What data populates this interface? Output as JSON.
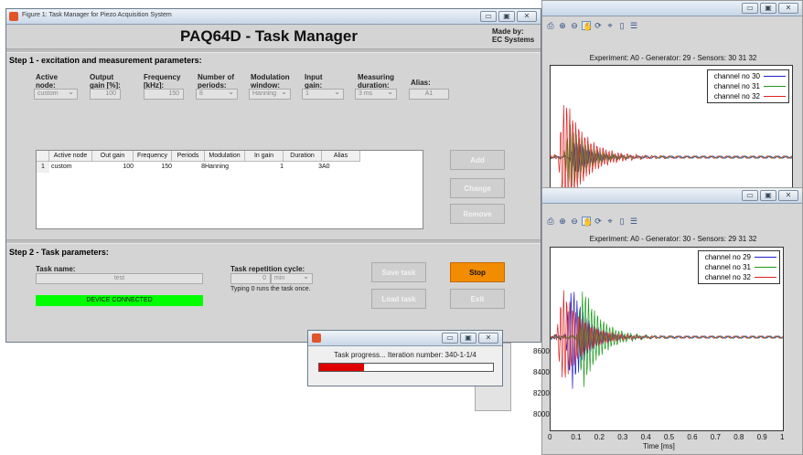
{
  "tm": {
    "window_title": "Figure 1: Task Manager for Piezo Acquisition System",
    "title": "PAQ64D - Task Manager",
    "made_by_1": "Made by:",
    "made_by_2": "EC Systems",
    "step1": "Step 1 - excitation and measurement parameters:",
    "labels": {
      "node": "Active\nnode:",
      "gain": "Output\ngain [%]:",
      "freq": "Frequency\n[kHz]:",
      "periods": "Number of\nperiods:",
      "window": "Modulation\nwindow:",
      "ingain": "Input\ngain:",
      "duration": "Measuring\nduration:",
      "alias": "Alias:"
    },
    "values": {
      "node": "custom",
      "gain": "100",
      "freq": "150",
      "periods": "8",
      "window": "Hanning",
      "ingain": "1",
      "duration": "3 ms",
      "alias": "A1"
    },
    "table": {
      "headers": [
        "",
        "Active node",
        "Out gain",
        "Frequency",
        "Periods",
        "Modulation",
        "In gain",
        "Duration",
        "Alias"
      ],
      "rows": [
        [
          "1",
          "custom",
          "100",
          "150",
          "8",
          "Hanning",
          "1",
          "3",
          "A0"
        ]
      ]
    },
    "buttons": {
      "add": "Add",
      "change": "Change",
      "remove": "Remove",
      "save": "Save task",
      "load": "Load task",
      "stop": "Stop",
      "exit": "Exit"
    },
    "step2": "Step 2 - Task parameters:",
    "task_name_label": "Task name:",
    "task_name": "test",
    "rep_label": "Task repetition cycle:",
    "rep_value": "0",
    "rep_unit": "min",
    "rep_note": "Typing 0 runs the task once.",
    "status": "DEVICE CONNECTED",
    "colors": {
      "stop": "#f28c00",
      "status": "#00ff00"
    }
  },
  "progress": {
    "text": "Task progress... Iteration number: 340-1-1/4",
    "fraction": 0.26,
    "color": "#e00000"
  },
  "plots": {
    "colors": [
      "#1f1fcf",
      "#1a9a1a",
      "#e02020"
    ],
    "top": {
      "title": "Experiment: A0 - Generator: 29 - Sensors: 30  31  32",
      "legend": [
        "channel no 30",
        "channel no 31",
        "channel no 32"
      ]
    },
    "bottom": {
      "title": "Experiment: A0 - Generator: 30 - Sensors: 29  31  32",
      "legend": [
        "channel no 29",
        "channel no 31",
        "channel no 32"
      ],
      "yticks": [
        "8600",
        "8400",
        "8200",
        "8000"
      ],
      "xticks": [
        "0",
        "0.1",
        "0.2",
        "0.3",
        "0.4",
        "0.5",
        "0.6",
        "0.7",
        "0.8",
        "0.9",
        "1"
      ],
      "xlabel": "Time [ms]"
    }
  },
  "chart_data": [
    {
      "type": "line",
      "title": "Experiment: A0 - Generator: 29 - Sensors: 30  31  32",
      "series": [
        {
          "name": "channel no 30"
        },
        {
          "name": "channel no 31"
        },
        {
          "name": "channel no 32"
        }
      ]
    },
    {
      "type": "line",
      "title": "Experiment: A0 - Generator: 30 - Sensors: 29  31  32",
      "xlabel": "Time [ms]",
      "xlim": [
        0,
        1
      ],
      "yticks": [
        8000,
        8200,
        8400,
        8600
      ],
      "series": [
        {
          "name": "channel no 29"
        },
        {
          "name": "channel no 31"
        },
        {
          "name": "channel no 32"
        }
      ]
    }
  ]
}
